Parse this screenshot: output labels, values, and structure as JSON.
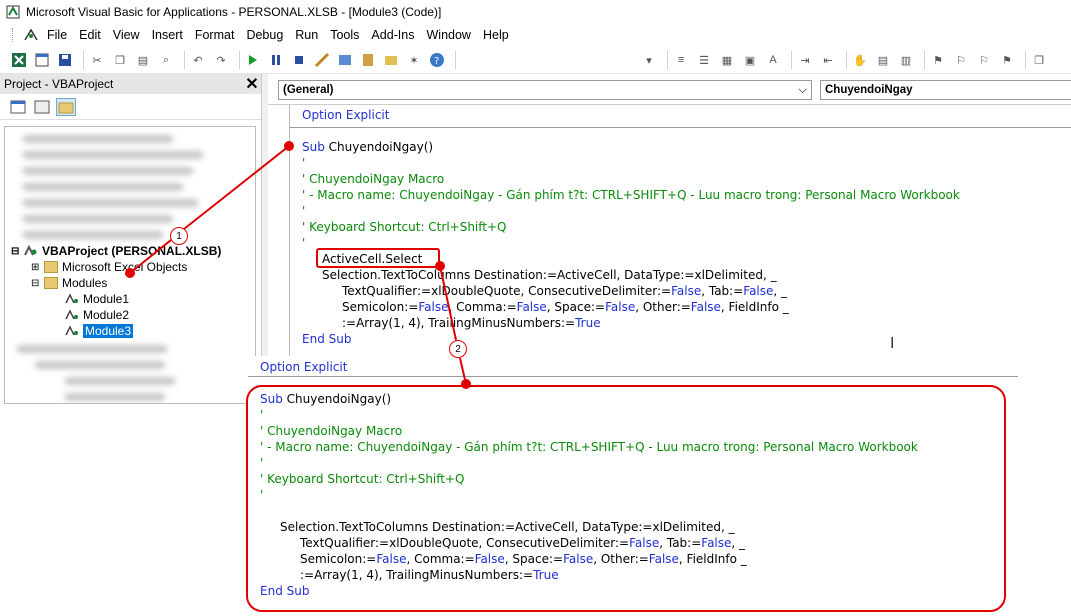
{
  "window": {
    "title": "Microsoft Visual Basic for Applications - PERSONAL.XLSB - [Module3 (Code)]"
  },
  "menu": [
    "File",
    "Edit",
    "View",
    "Insert",
    "Format",
    "Debug",
    "Run",
    "Tools",
    "Add-Ins",
    "Window",
    "Help"
  ],
  "project_pane": {
    "title": "Project - VBAProject",
    "close": "✕",
    "tree": {
      "root": "VBAProject (PERSONAL.XLSB)",
      "excel_objects": "Microsoft Excel Objects",
      "modules": "Modules",
      "items": [
        "Module1",
        "Module2",
        "Module3"
      ]
    }
  },
  "code_pane": {
    "object_combo": "(General)",
    "proc_combo": "ChuyendoiNgay"
  },
  "code": {
    "option": "Option Explicit",
    "sub_kw": "Sub",
    "sub_name": "ChuyendoiNgay()",
    "c1": "'",
    "c2": "' ChuyendoiNgay Macro",
    "c3": "' - Macro name: ChuyendoiNgay - Gán phím t?t: CTRL+SHIFT+Q - Luu macro trong: Personal Macro Workbook",
    "c4": "'",
    "c5": "' Keyboard Shortcut: Ctrl+Shift+Q",
    "c6": "'",
    "select": "ActiveCell.Select",
    "l1": "Selection.TextToColumns Destination:=ActiveCell, DataType:=xlDelimited, _",
    "l2a": "TextQualifier:=xlDoubleQuote, ConsecutiveDelimiter:=",
    "l2b": "False",
    "l2c": ", Tab:=",
    "l2d": "False",
    "l2e": ", _",
    "l3a": "Semicolon:=",
    "l3b": "False",
    "l3c": ", Comma:=",
    "l3d": "False",
    "l3e": ", Space:=",
    "l3f": "False",
    "l3g": ", Other:=",
    "l3h": "False",
    "l3i": ", FieldInfo _",
    "l4a": ":=Array(1, 4), TrailingMinusNumbers:=",
    "l4b": "True",
    "end": "End Sub"
  },
  "annotations": {
    "one": "1",
    "two": "2"
  },
  "colors": {
    "keyword": "#1f2fd0",
    "comment": "#0a8a0a",
    "annotation": "#e00000",
    "selection": "#0078d7"
  }
}
